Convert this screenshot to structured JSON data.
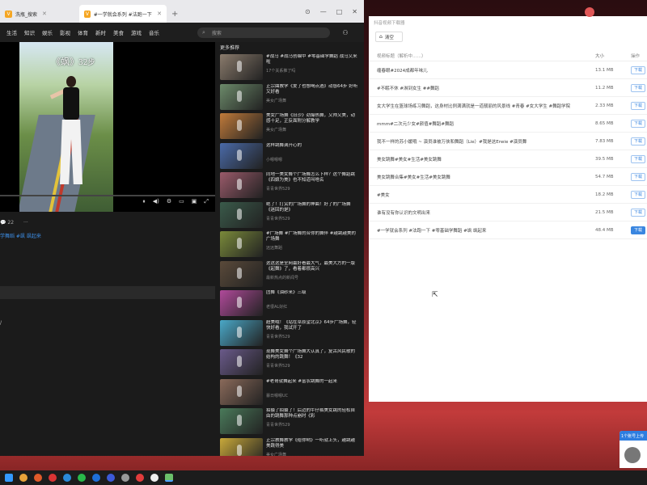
{
  "browser": {
    "tabs": [
      {
        "label": "洗瓶_搜索",
        "active": false
      },
      {
        "label": "#一学就会系列 #法跑一下 #零基础",
        "active": true
      }
    ],
    "new_tab": "+",
    "window_controls": [
      "⊙",
      "—",
      "□",
      "✕"
    ],
    "nav": [
      "生活",
      "知识",
      "娱乐",
      "影视",
      "体育",
      "新时",
      "美食",
      "游戏",
      "音乐"
    ],
    "search_placeholder": "搜索"
  },
  "player": {
    "title_main": "《飒》",
    "title_sub": "32步",
    "controls": [
      "⏸",
      "◀)",
      "⚙",
      "▭",
      "▣",
      "⤢"
    ]
  },
  "below_player": {
    "comment_icon": "💬",
    "comment_count": "22",
    "more": "···",
    "tags": "学舞蹈 #飒 飒起来"
  },
  "left_mark": "/",
  "recommendations": {
    "title": "更多推荐",
    "items": [
      {
        "title": "#战马 #战马创编中 #零基础学舞蹈 战马又来啦",
        "meta": "17个关系推了吗",
        "color": "#8a7b6c"
      },
      {
        "title": "正宗曲教学《爱了也想喝点酒》动感64步 好听又好看",
        "meta": "美女广场舞",
        "color": "#6c8a6a"
      },
      {
        "title": "美女广场舞《旧沙》劲爆热舞，又帅又美，动感十足，正反面附分解教学",
        "meta": "美女广场舞",
        "color": "#c07a3a"
      },
      {
        "title": "这样跳舞满开心的",
        "meta": "小嗯嗯嗯",
        "color": "#4a6aa8"
      },
      {
        "title": "同地一美女舞个广场舞怎么下样？这个舞蹈跳《四娘为美》也不知道叫啥名",
        "meta": "青青世界529",
        "color": "#9a5a6a"
      },
      {
        "title": "绝了！打赏的广场舞的神曲！好了的广场舞《迷回的是》",
        "meta": "青青世界529",
        "color": "#3a5a4a"
      },
      {
        "title": "#广场舞 #广场舞的合你的舞伴 #越跳越美的广场舞",
        "meta": "远远舞蹈",
        "color": "#7a8a3a"
      },
      {
        "title": "这这这是全网最好看最大气，最美大方的一版《起舞》了，看着都很高兴",
        "meta": "最新热点的新闻号",
        "color": "#5a4a3a"
      },
      {
        "title": "团舞《油砂来》三级",
        "meta": "老很AL好红",
        "color": "#b04a9a"
      },
      {
        "title": "超美哦！《站在草原望北京》64步广场舞，轻快好看，我试开了",
        "meta": "青青世界529",
        "color": "#4aa8c8"
      },
      {
        "title": "现舞美女舞个广场舞大认真了，复古风民歌的结构的跳舞！《32",
        "meta": "青青世界529",
        "color": "#6a5a8a"
      },
      {
        "title": "#老哥就舞起来 #富农跳舞的一起来",
        "meta": "暴日嗯嗯UC",
        "color": "#8a6a5a"
      },
      {
        "title": "拍摄了拍摄了！后边的牛仔裤美女跳的轻松自由的跳舞那种点崩时《彩",
        "meta": "青青世界529",
        "color": "#4a7a5a"
      },
      {
        "title": "正宗教舞教学《给你哟》一听就上头，越跳越美跳得美",
        "meta": "美女广场舞",
        "color": "#c8a83a"
      }
    ]
  },
  "app": {
    "title": "抖音视频下载器",
    "clear_label": "清空",
    "clear_icon": "⌂",
    "headers": {
      "title": "视频标题（解析中……）",
      "size": "大小",
      "op": "操作"
    },
    "rows": [
      {
        "title": "缠春眼#2024成都年味儿",
        "size": "13.1 MB",
        "op": "下载",
        "filled": false
      },
      {
        "title": "#不眠不休 #淋到女生 ##舞蹈",
        "size": "11.2 MB",
        "op": "下载",
        "filled": false
      },
      {
        "title": "女大学生在篮球场练习舞蹈，这身材比例满满就是一道靓丽的风景线 #青春 #女大学生 #舞蹈学院",
        "size": "2.33 MB",
        "op": "下载",
        "filled": false
      },
      {
        "title": "mmm#二次元少女#颜值#舞蹈#舞蹈",
        "size": "8.65 MB",
        "op": "下载",
        "filled": false
      },
      {
        "title": "我不一样的苏小媛哦 ~ 演员谁被万侠和舞蹈（Lie）#我是这Erwie #演员舞",
        "size": "7.83 MB",
        "op": "下载",
        "filled": false
      },
      {
        "title": "美女跳舞#美女#生活#美女跳舞",
        "size": "39.5 MB",
        "op": "下载",
        "filled": false
      },
      {
        "title": "美女跳舞合集#美女#生活#美女跳舞",
        "size": "54.7 MB",
        "op": "下载",
        "filled": false
      },
      {
        "title": "#美女",
        "size": "18.2 MB",
        "op": "下载",
        "filled": false
      },
      {
        "title": "谁有没有你认识的文明出来",
        "size": "21.5 MB",
        "op": "下载",
        "filled": false
      },
      {
        "title": "#一学就会系列 #法跑一下 #零基础学舞蹈 #飒 飒起来",
        "size": "48.4 MB",
        "op": "下载",
        "filled": true
      }
    ]
  },
  "notification": {
    "header": "1个账号上传"
  },
  "mouse_cursor": "⇱",
  "colors": {
    "accent": "#3a86e0",
    "link": "#3d8ee6"
  }
}
